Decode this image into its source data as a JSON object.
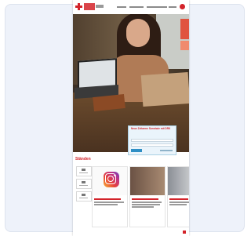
{
  "login": {
    "title": "Neue Zeitarme Sonstwie mit DRK",
    "field1": "",
    "field2": ""
  },
  "sections": {
    "hilfe_title": "Ständen"
  },
  "colors": {
    "brand_red": "#d3232a",
    "login_bg": "#eaf4fb",
    "button_blue": "#2f8fc5"
  },
  "icons": [
    "red-cross-logo",
    "instagram-icon"
  ]
}
